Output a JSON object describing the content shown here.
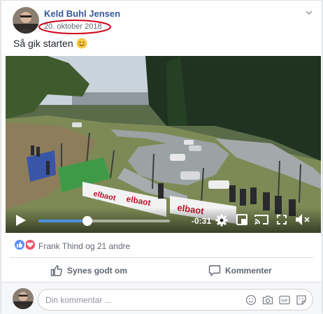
{
  "post": {
    "author": "Keld Buhl Jensen",
    "date": "20. oktober 2018",
    "text": "Så gik starten",
    "emoji": "smiling-face-emoji"
  },
  "video": {
    "time_remaining": "-0:31",
    "progress_fraction": 0.37,
    "scene_banners": [
      "elbaot",
      "elbaot",
      "elbaot"
    ]
  },
  "reactions": {
    "types": [
      "like",
      "love"
    ],
    "summary": "Frank Thind og 21 andre"
  },
  "actions": {
    "like_label": "Synes godt om",
    "comment_label": "Kommenter"
  },
  "comment_box": {
    "placeholder": "Din kommentar ..."
  },
  "colors": {
    "author_link": "#365899",
    "date_highlight": "#d0021b",
    "like_blue": "#5890ff",
    "love_red": "#f25268",
    "progress_blue": "#4a90e2"
  }
}
